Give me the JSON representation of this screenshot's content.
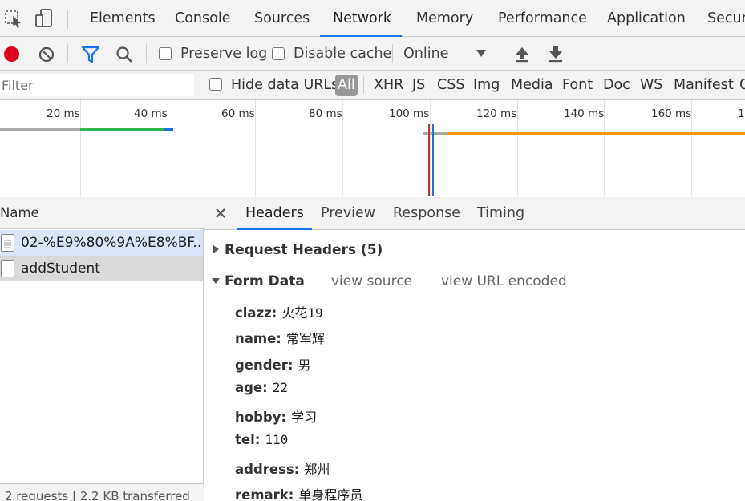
{
  "top_tabs": [
    "Elements",
    "Console",
    "Sources",
    "Network",
    "Memory",
    "Performance",
    "Application",
    "Securi"
  ],
  "active_top_tab": "Network",
  "toolbar": {
    "preserve_log": "Preserve log",
    "disable_cache": "Disable cache",
    "throttle": "Online"
  },
  "filter": {
    "placeholder": "Filter",
    "hide_data_urls": "Hide data URLs",
    "types": [
      "All",
      "XHR",
      "JS",
      "CSS",
      "Img",
      "Media",
      "Font",
      "Doc",
      "WS",
      "Manifest",
      "O"
    ]
  },
  "timeline": {
    "ticks": [
      "20 ms",
      "40 ms",
      "60 ms",
      "80 ms",
      "100 ms",
      "120 ms",
      "140 ms",
      "160 ms",
      "1"
    ]
  },
  "requests": {
    "header": "Name",
    "items": [
      "02-%E9%80%9A%E8%BF...",
      "addStudent"
    ],
    "footer": "2 requests  |  2.2 KB transferred"
  },
  "details": {
    "tabs": [
      "Headers",
      "Preview",
      "Response",
      "Timing"
    ],
    "active_tab": "Headers",
    "request_headers": "Request Headers (5)",
    "form_data": "Form Data",
    "view_source": "view source",
    "view_url_encoded": "view URL encoded",
    "fields": [
      {
        "key": "clazz:",
        "value": "火花19"
      },
      {
        "key": "name:",
        "value": "常军辉"
      },
      {
        "key": "gender:",
        "value": "男"
      },
      {
        "key": "age:",
        "value": "22"
      },
      {
        "key": "hobby:",
        "value": "学习"
      },
      {
        "key": "tel:",
        "value": "110"
      },
      {
        "key": "address:",
        "value": "郑州"
      },
      {
        "key": "remark:",
        "value": "单身程序员"
      }
    ]
  },
  "colors": {
    "accent": "#1a73e8",
    "record": "#e0001b",
    "bar_green": "#2db84d",
    "bar_orange": "#f29900"
  }
}
